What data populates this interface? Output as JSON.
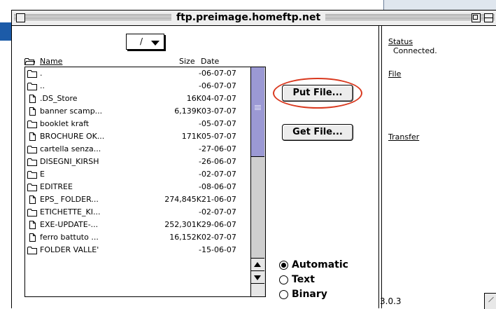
{
  "window": {
    "title": "ftp.preimage.homeftp.net"
  },
  "path_popup": {
    "value": "/"
  },
  "list": {
    "headers": {
      "name": "Name",
      "size": "Size",
      "date": "Date"
    },
    "rows": [
      {
        "icon": "folder-icon",
        "name": ".",
        "size": "-",
        "date": "06-07-07"
      },
      {
        "icon": "folder-icon",
        "name": "..",
        "size": "-",
        "date": "06-07-07"
      },
      {
        "icon": "document-icon",
        "name": ".DS_Store",
        "size": "16K",
        "date": "04-07-07"
      },
      {
        "icon": "document-icon",
        "name": "banner scamp...",
        "size": "6,139K",
        "date": "03-07-07"
      },
      {
        "icon": "folder-icon",
        "name": "booklet kraft",
        "size": "-",
        "date": "05-07-07"
      },
      {
        "icon": "document-icon",
        "name": "BROCHURE OK...",
        "size": "171K",
        "date": "05-07-07"
      },
      {
        "icon": "folder-icon",
        "name": "cartella senza...",
        "size": "-",
        "date": "27-06-07"
      },
      {
        "icon": "folder-icon",
        "name": "DISEGNI_KIRSH",
        "size": "-",
        "date": "26-06-07"
      },
      {
        "icon": "folder-icon",
        "name": "E",
        "size": "-",
        "date": "02-07-07"
      },
      {
        "icon": "folder-icon",
        "name": "EDITREE",
        "size": "-",
        "date": "08-06-07"
      },
      {
        "icon": "document-icon",
        "name": "EPS_ FOLDER...",
        "size": "274,845K",
        "date": "21-06-07"
      },
      {
        "icon": "folder-icon",
        "name": "ETICHETTE_KI...",
        "size": "-",
        "date": "02-07-07"
      },
      {
        "icon": "document-icon",
        "name": "EXE-UPDATE-...",
        "size": "252,301K",
        "date": "29-06-07"
      },
      {
        "icon": "document-icon",
        "name": "ferro battuto ...",
        "size": "16,152K",
        "date": "02-07-07"
      },
      {
        "icon": "folder-icon",
        "name": "FOLDER VALLE'",
        "size": "-",
        "date": "15-06-07"
      }
    ]
  },
  "buttons": {
    "put_file": "Put File...",
    "get_file": "Get File..."
  },
  "transfer_mode": {
    "options": [
      {
        "label": "Automatic",
        "selected": true
      },
      {
        "label": "Text",
        "selected": false
      },
      {
        "label": "Binary",
        "selected": false
      }
    ]
  },
  "status_panel": {
    "status_label": "Status",
    "status_value": "Connected.",
    "file_label": "File",
    "transfer_label": "Transfer",
    "version": "3.0.3"
  },
  "colors": {
    "highlight_ring": "#d9391f",
    "scroll_thumb": "#9b99d4",
    "desktop_accent": "#1c5ba8"
  }
}
